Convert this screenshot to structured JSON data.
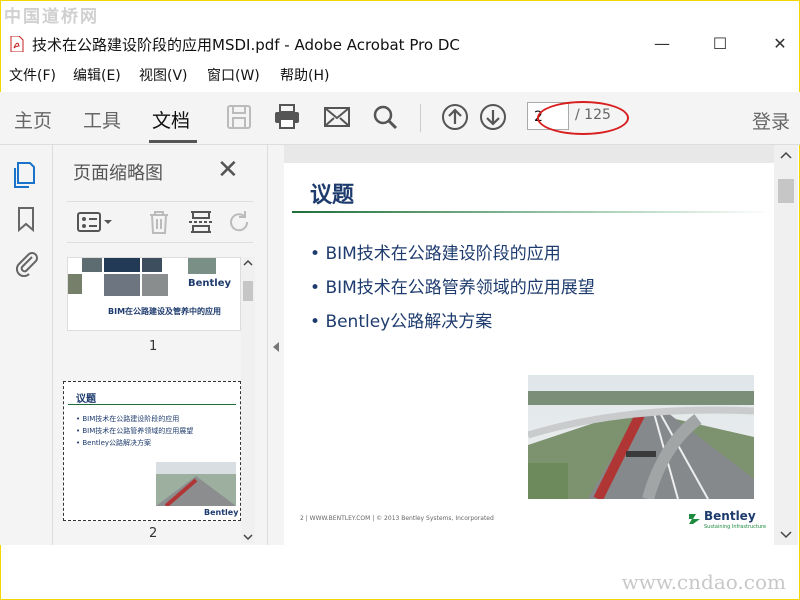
{
  "watermarks": {
    "top": "中国道桥网",
    "bottom": "www.cndao.com"
  },
  "window": {
    "title": "技术在公路建设阶段的应用MSDI.pdf - Adobe Acrobat Pro DC",
    "minimize": "—",
    "maximize": "☐",
    "close": "✕"
  },
  "menu": [
    "文件(F)",
    "编辑(E)",
    "视图(V)",
    "窗口(W)",
    "帮助(H)"
  ],
  "toolbar": {
    "tabs": [
      "主页",
      "工具",
      "文档"
    ],
    "active_tab": "文档",
    "page_current": "2",
    "page_total": "/ 125",
    "login": "登录",
    "icons": [
      "save-icon",
      "print-icon",
      "mail-icon",
      "search-icon",
      "page-up-icon",
      "page-down-icon"
    ]
  },
  "thumb_panel": {
    "title": "页面缩略图",
    "close": "✕",
    "pages": [
      {
        "number": "1",
        "caption": "BIM在公路建设及管养中的应用",
        "brand": "Bentley"
      },
      {
        "number": "2",
        "heading": "议题",
        "bullets": [
          "BIM技术在公路建设阶段的应用",
          "BIM技术在公路管养领域的应用展望",
          "Bentley公路解决方案"
        ],
        "brand": "Bentley"
      }
    ]
  },
  "document": {
    "heading": "议题",
    "bullets": [
      "BIM技术在公路建设阶段的应用",
      "BIM技术在公路管养领域的应用展望",
      "Bentley公路解决方案"
    ],
    "footer": "2  |  WWW.BENTLEY.COM  |  © 2013 Bentley Systems, Incorporated",
    "brand": "Bentley",
    "brand_tagline": "Sustaining Infrastructure"
  },
  "colors": {
    "heading": "#1e3b6e",
    "annotation": "#d81e1e",
    "frame": "#f2d800"
  }
}
